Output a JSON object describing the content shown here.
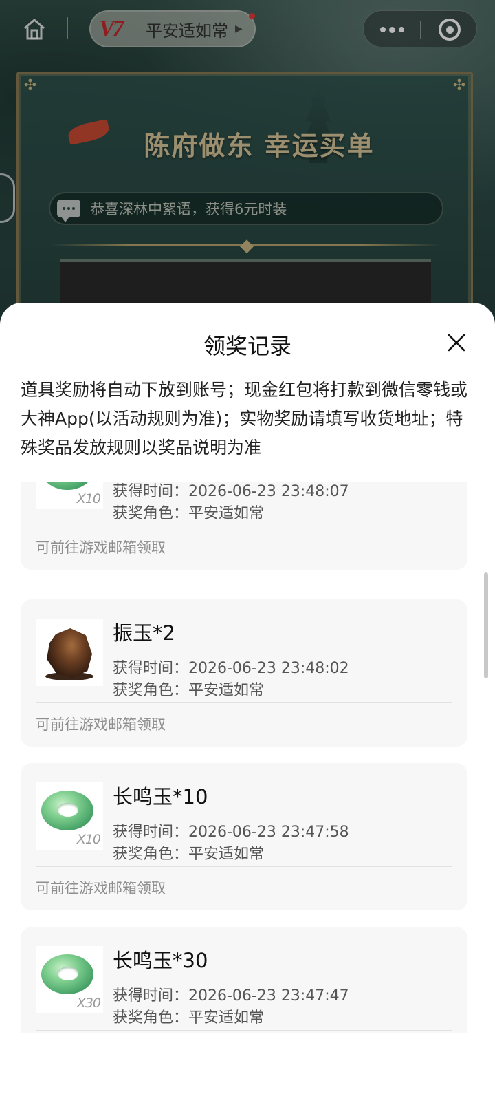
{
  "topbar": {
    "game_logo": "V7",
    "game_name": "平安适如常",
    "home_icon": "home-icon",
    "more_icon": "more-dots-icon",
    "close_icon": "target-close-icon"
  },
  "banner": {
    "title": "陈府做东 幸运买单",
    "marquee": "恭喜深林中絮语，获得6元时装"
  },
  "sheet": {
    "title": "领奖记录",
    "notice": "道具奖励将自动下放到账号；现金红包将打款到微信零钱或大神App(以活动规则为准)；实物奖励请填写收货地址；特殊奖品发放规则以奖品说明为准",
    "close_icon": "close-icon"
  },
  "records": [
    {
      "name": "",
      "qty_badge": "X10",
      "image": "jade-ring-icon",
      "time": "获得时间：2026-06-23 23:48:07",
      "role": "获奖角色：平安适如常",
      "hint": "可前往游戏邮箱领取"
    },
    {
      "name": "振玉*2",
      "qty_badge": "",
      "image": "stone-icon",
      "time": "获得时间：2026-06-23 23:48:02",
      "role": "获奖角色：平安适如常",
      "hint": "可前往游戏邮箱领取"
    },
    {
      "name": "长鸣玉*10",
      "qty_badge": "X10",
      "image": "jade-ring-icon",
      "time": "获得时间：2026-06-23 23:47:58",
      "role": "获奖角色：平安适如常",
      "hint": "可前往游戏邮箱领取"
    },
    {
      "name": "长鸣玉*30",
      "qty_badge": "X30",
      "image": "jade-ring-icon",
      "time": "获得时间：2026-06-23 23:47:47",
      "role": "获奖角色：平安适如常",
      "hint": ""
    }
  ],
  "colors": {
    "accent_gold": "#c9b783",
    "sheet_bg": "#ffffff",
    "card_bg": "#f7f7f7",
    "logo_red": "#c7282a"
  }
}
